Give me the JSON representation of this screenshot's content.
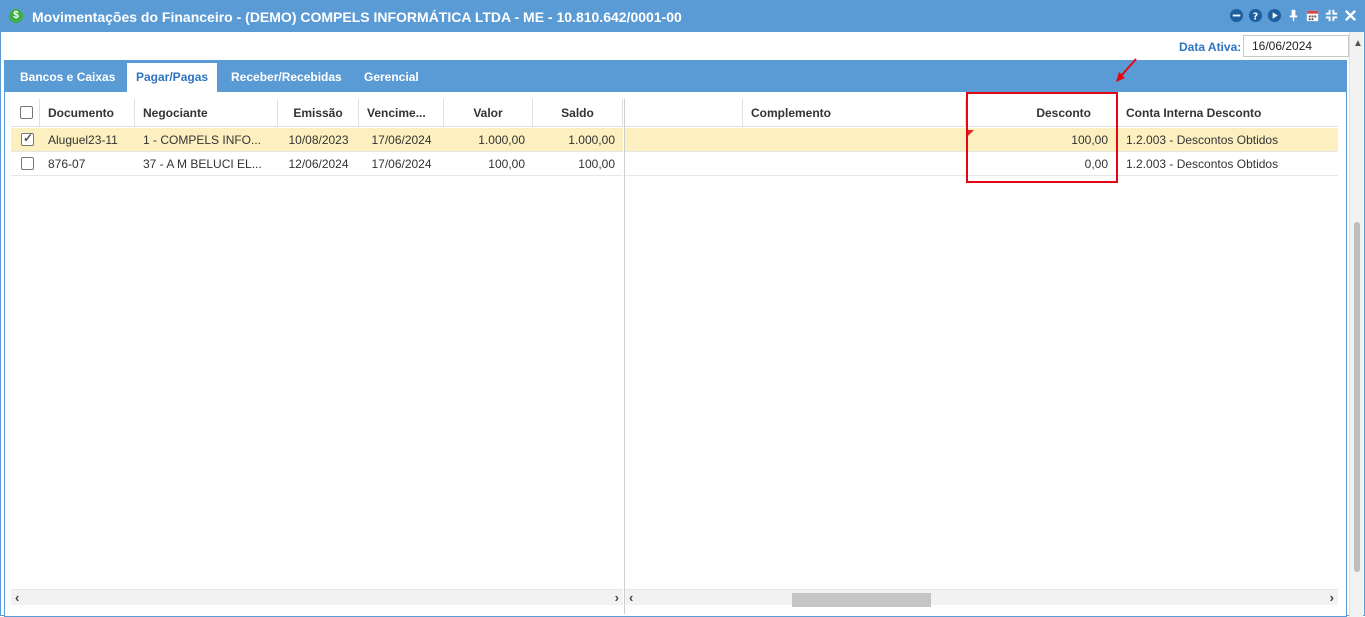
{
  "window": {
    "title": "Movimentações do Financeiro - (DEMO) COMPELS INFORMÁTICA LTDA - ME - 10.810.642/0001-00",
    "app_icon": "$"
  },
  "titlebar_icons": [
    "minimize-circle-icon",
    "help-icon",
    "play-icon",
    "pin-icon",
    "calendar-icon",
    "compress-icon",
    "close-icon"
  ],
  "date": {
    "label": "Data Ativa:",
    "value": "16/06/2024"
  },
  "tabs": [
    {
      "label": "Bancos e Caixas"
    },
    {
      "label": "Pagar/Pagas"
    },
    {
      "label": "Receber/Recebidas"
    },
    {
      "label": "Gerencial"
    }
  ],
  "left_grid": {
    "headers": {
      "documento": "Documento",
      "negociante": "Negociante",
      "emissao": "Emissão",
      "vencimento": "Vencime...",
      "valor": "Valor",
      "saldo": "Saldo"
    },
    "rows": [
      {
        "checked": true,
        "documento": "Aluguel23-11",
        "negociante": "1 - COMPELS INFO...",
        "emissao": "10/08/2023",
        "vencimento": "17/06/2024",
        "valor": "1.000,00",
        "saldo": "1.000,00"
      },
      {
        "checked": false,
        "documento": "876-07",
        "negociante": "37 - A M BELUCI EL...",
        "emissao": "12/06/2024",
        "vencimento": "17/06/2024",
        "valor": "100,00",
        "saldo": "100,00"
      }
    ]
  },
  "right_grid": {
    "headers": {
      "complemento": "Complemento",
      "desconto": "Desconto",
      "conta": "Conta Interna Desconto"
    },
    "rows": [
      {
        "complemento": "",
        "desconto": "100,00",
        "conta": "1.2.003 - Descontos Obtidos"
      },
      {
        "complemento": "",
        "desconto": "0,00",
        "conta": "1.2.003 - Descontos Obtidos"
      }
    ]
  },
  "colors": {
    "accent": "#5b9bd5",
    "highlight": "#e30613",
    "selected_row": "#fdf0c0"
  }
}
